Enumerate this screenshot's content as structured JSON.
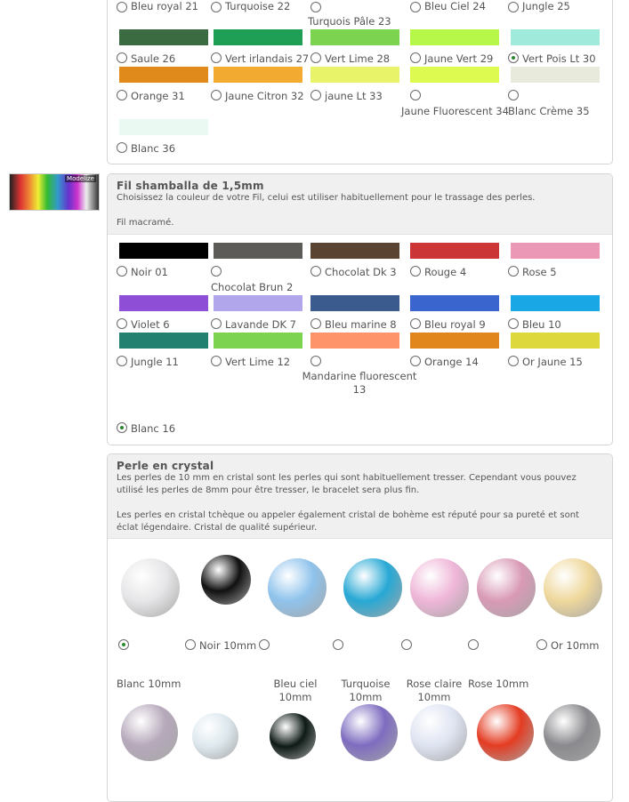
{
  "thumbnail": {
    "brand": "Modelize"
  },
  "colors": {
    "radio_checked": "#2a8a2a"
  },
  "section1": {
    "top_labels": [
      "Bleu royal 21",
      "Turquoise 22",
      "Turquois Pâle 23",
      "Bleu Ciel 24",
      "Jungle 25"
    ],
    "row1": {
      "swatches": [
        "#3a6b41",
        "#1f9e55",
        "#7bd34f",
        "#b7f74a",
        "#a0eadb"
      ],
      "labels": [
        "Saule 26",
        "Vert irlandais 27",
        "Vert Lime 28",
        "Jaune Vert 29",
        "Vert Pois Lt 30"
      ]
    },
    "row2": {
      "swatches": [
        "#e08a1c",
        "#f2ab30",
        "#e9f36a",
        "#dcfa50",
        "#e8eadc"
      ],
      "labels": [
        "Orange 31",
        "Jaune Citron 32",
        "jaune Lt 33",
        "Jaune Fluorescent 34",
        "Blanc Crème 35"
      ]
    },
    "row3": {
      "swatch": "#eafaf2",
      "label": "Blanc 36"
    }
  },
  "section2": {
    "title": "Fil shamballa de 1,5mm",
    "description": "Choisissez la couleur de votre Fil, celui est utiliser habituellement pour le trassage des perles.\n\nFil macramé.",
    "row1": {
      "swatches": [
        "#000000",
        "#5c5b58",
        "#5a4431",
        "#cc3535",
        "#ea98b6"
      ],
      "labels": [
        "Noir 01",
        "Chocolat Brun 2",
        "Chocolat Dk 3",
        "Rouge 4",
        "Rose 5"
      ]
    },
    "row2": {
      "swatches": [
        "#8e4fd6",
        "#b1a5ec",
        "#3b5a8e",
        "#3a65cf",
        "#1aa7e6"
      ],
      "labels": [
        "Violet 6",
        "Lavande DK 7",
        "Bleu marine 8",
        "Bleu royal 9",
        "Bleu 10"
      ]
    },
    "row3": {
      "swatches": [
        "#218070",
        "#7bd34f",
        "#fd946a",
        "#e0861d",
        "#ddd93d"
      ],
      "labels": [
        "Jungle 11",
        "Vert Lime 12",
        "Mandarine fluorescent 13",
        "Orange 14",
        "Or Jaune 15"
      ]
    },
    "row4": {
      "label": "Blanc 16"
    }
  },
  "section3": {
    "title": "Perle en crystal",
    "description": "Les perles de 10 mm en cristal sont les perles qui sont habituellement tresser. Cependant vous pouvez utilisé les perles de 8mm pour être tresser, le bracelet sera plus fin.\n\nLes perles en cristal tchèque ou appeler également cristal de bohème est réputé pour sa pureté et sont éclat légendaire. Cristal de qualité supérieur.",
    "beads_row1": {
      "colors": [
        "#e6e6e8",
        "#111111",
        "#8fc3ec",
        "#27a8d4",
        "#efb6d8",
        "#d99ab6",
        "#efd89c"
      ],
      "labels": [
        "Blanc 10mm",
        "Noir 10mm",
        "Bleu ciel 10mm",
        "Turquoise 10mm",
        "Rose claire 10mm",
        "Rose 10mm",
        "Or 10mm"
      ]
    },
    "beads_row2": {
      "colors": [
        "#b6a9bb",
        "#dde8ee",
        "#0e1a16",
        "#7e6cc0",
        "#dfe4f2",
        "#e43c22",
        "#8a8a8e"
      ]
    }
  }
}
